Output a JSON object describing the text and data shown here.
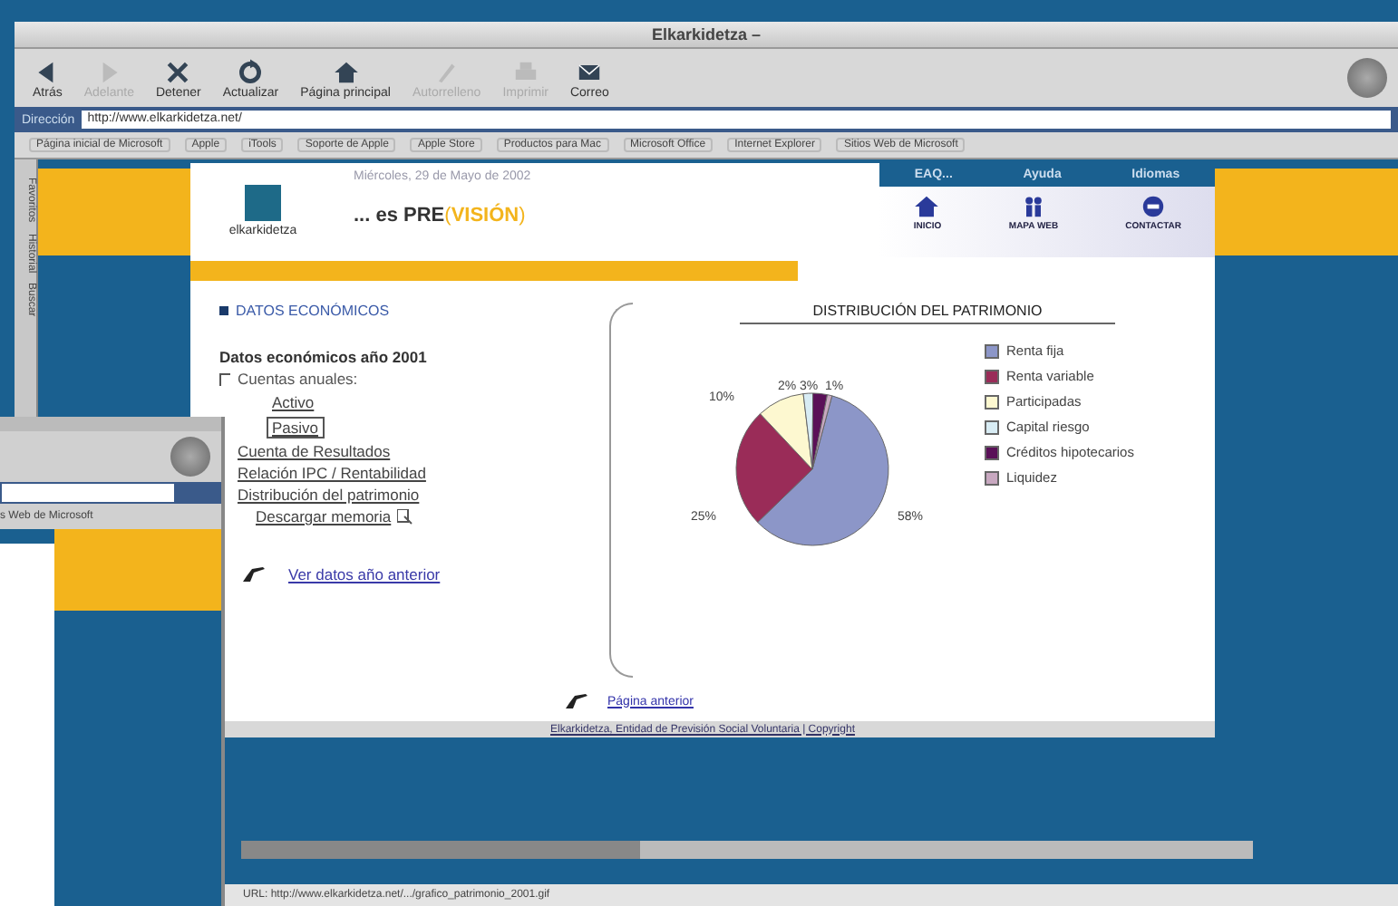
{
  "window": {
    "title": "Elkarkidetza –"
  },
  "toolbar": [
    {
      "kind": "back",
      "label": "Atrás",
      "disabled": false
    },
    {
      "kind": "forward",
      "label": "Adelante",
      "disabled": true
    },
    {
      "kind": "stop",
      "label": "Detener",
      "disabled": false
    },
    {
      "kind": "refresh",
      "label": "Actualizar",
      "disabled": false
    },
    {
      "kind": "home",
      "label": "Página principal",
      "disabled": false
    },
    {
      "kind": "autofill",
      "label": "Autorrelleno",
      "disabled": true
    },
    {
      "kind": "print",
      "label": "Imprimir",
      "disabled": true
    },
    {
      "kind": "mail",
      "label": "Correo",
      "disabled": false
    }
  ],
  "address": {
    "label": "Dirección",
    "value": "http://www.elkarkidetza.net/"
  },
  "favorites": [
    "Página inicial de Microsoft",
    "Apple",
    "iTools",
    "Soporte de Apple",
    "Apple Store",
    "Productos para Mac",
    "Microsoft Office",
    "Internet Explorer",
    "Sitios Web de Microsoft"
  ],
  "side_tabs": [
    "Favoritos",
    "Historial",
    "Buscar"
  ],
  "page": {
    "logo": "elkarkidetza",
    "date": "Miércoles, 29 de Mayo de 2002",
    "tagline": {
      "lead": "... es PRE",
      "open": "(",
      "word": "VISIÓN",
      "close": ")"
    },
    "nav_links": [
      "EAQ...",
      "Ayuda",
      "Idiomas"
    ],
    "nav_icons": [
      {
        "kind": "home",
        "label": "INICIO"
      },
      {
        "kind": "people",
        "label": "MAPA WEB"
      },
      {
        "kind": "contact",
        "label": "CONTACTAR"
      }
    ],
    "section_title": "DATOS ECONÓMICOS",
    "subtitle": "Datos económicos año 2001",
    "menu": [
      {
        "label": "Cuentas anuales:",
        "kind": "group",
        "children": [
          {
            "label": "Activo",
            "selected": false
          },
          {
            "label": "Pasivo",
            "selected": true
          }
        ]
      },
      {
        "label": "Cuenta de Resultados",
        "kind": "link"
      },
      {
        "label": "Relación IPC / Rentabilidad",
        "kind": "link"
      },
      {
        "label": "Distribución del patrimonio",
        "kind": "link"
      },
      {
        "label": "Descargar memoria",
        "kind": "download"
      }
    ],
    "previous_year_link": "Ver datos año anterior",
    "chart": {
      "chart_data": {
        "type": "pie",
        "title": "DISTRIBUCIÓN DEL PATRIMONIO",
        "categories": [
          "Renta fija",
          "Renta variable",
          "Participadas",
          "Capital riesgo",
          "Créditos hipotecarios",
          "Liquidez"
        ],
        "series": [
          {
            "values": [
              58,
              25,
              10,
              2,
              3,
              1
            ],
            "colors": [
              "#8c96c8",
              "#9a2c58",
              "#fdf8d0",
              "#d8ecf4",
              "#5a1058",
              "#c8a8c0"
            ]
          }
        ],
        "value_labels": [
          "58%",
          "25%",
          "10%",
          "2%",
          "3%",
          "1%"
        ]
      }
    },
    "back_link": "Página anterior",
    "footer": "Elkarkidetza, Entidad de Previsión Social Voluntaria | Copyright"
  },
  "status_bar": "URL: http://www.elkarkidetza.net/.../grafico_patrimonio_2001.gif",
  "back_window": {
    "favorite": "s Web de Microsoft"
  }
}
